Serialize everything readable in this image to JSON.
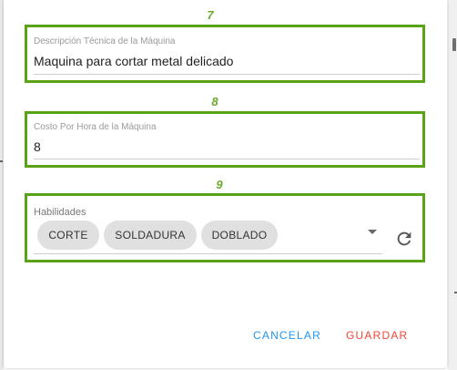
{
  "annotations": [
    "7",
    "8",
    "9"
  ],
  "fields": {
    "description": {
      "label": "Descripción Técnica de la Máquina",
      "value": "Maquina para cortar metal delicado"
    },
    "cost": {
      "label": "Costo Por Hora de la Máquina",
      "value": "8"
    },
    "skills": {
      "label": "Habilidades",
      "chips": [
        "CORTE",
        "SOLDADURA",
        "DOBLADO"
      ]
    }
  },
  "actions": {
    "cancel_label": "CANCELAR",
    "save_label": "GUARDAR"
  },
  "colors": {
    "highlight": "#5aa317",
    "cancel": "#2196f3",
    "save": "#f44336"
  }
}
